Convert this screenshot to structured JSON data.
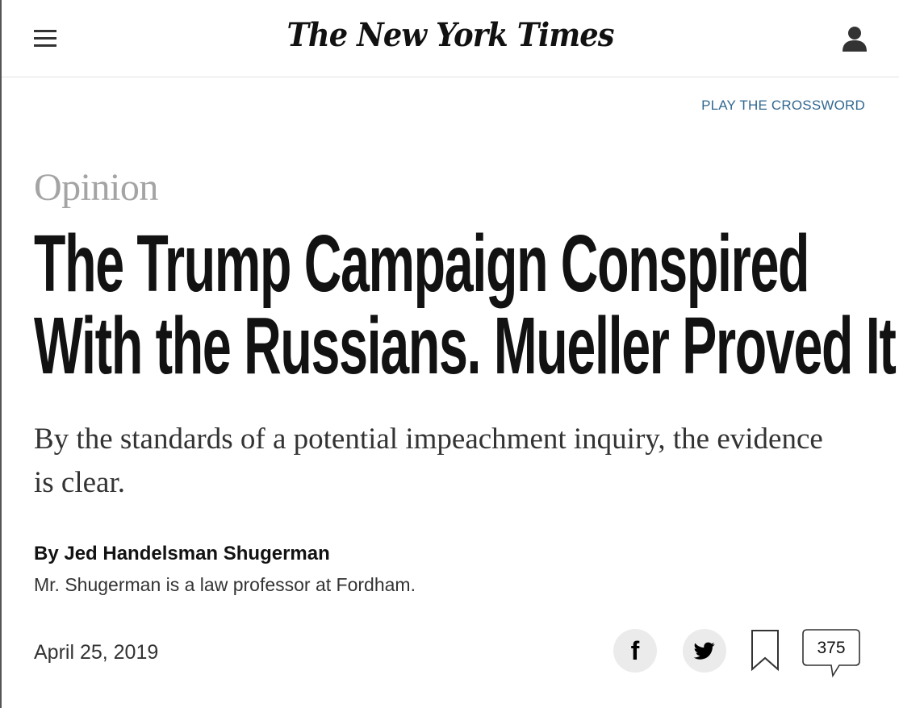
{
  "masthead": {
    "logo_text": "The New York Times",
    "menu_icon": "hamburger-menu-icon",
    "account_icon": "user-account-icon"
  },
  "crossword_link": "PLAY THE CROSSWORD",
  "article": {
    "kicker": "Opinion",
    "headline_line1": "The Trump Campaign Conspired",
    "headline_line2": "With the Russians. Mueller Proved It.",
    "summary": "By the standards of a potential impeachment inquiry, the evidence is clear.",
    "byline": "By Jed Handelsman Shugerman",
    "author_bio": "Mr. Shugerman is a law professor at Fordham.",
    "date": "April 25, 2019"
  },
  "share_tools": {
    "facebook_glyph": "f",
    "facebook_icon": "facebook-icon",
    "twitter_icon": "twitter-icon",
    "save_icon": "bookmark-icon",
    "comments_icon": "speech-bubble-icon",
    "comment_count": "375"
  },
  "colors": {
    "link": "#326891",
    "kicker": "#a4a4a4",
    "text": "#121212",
    "share_bg": "#ebebeb"
  }
}
